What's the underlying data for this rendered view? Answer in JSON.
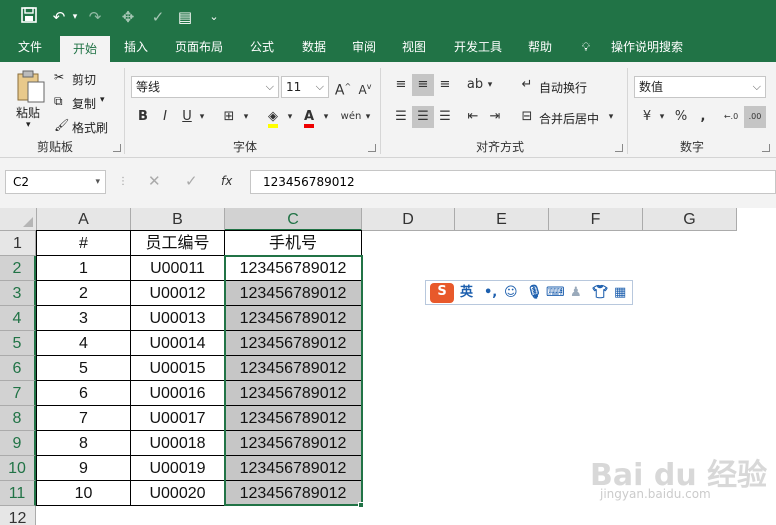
{
  "colors": {
    "accent": "#217346",
    "selection_fill": "#c6c6c6"
  },
  "qat": {
    "save_icon": "save-icon",
    "undo_icon": "undo-icon",
    "redo_icon": "redo-icon",
    "more": "⌄"
  },
  "tabs": [
    "文件",
    "开始",
    "插入",
    "页面布局",
    "公式",
    "数据",
    "审阅",
    "视图",
    "开发工具",
    "帮助"
  ],
  "tell_me": "操作说明搜索",
  "ribbon": {
    "clipboard": {
      "paste": "粘贴",
      "cut": "剪切",
      "copy": "复制",
      "format_painter": "格式刷",
      "label": "剪贴板"
    },
    "font": {
      "name": "等线",
      "size": "11",
      "bold": "B",
      "italic": "I",
      "underline": "U",
      "grow": "A",
      "shrink": "A",
      "phonetic": "wén",
      "label": "字体"
    },
    "alignment": {
      "wrap": "自动换行",
      "merge": "合并后居中",
      "label": "对齐方式"
    },
    "number": {
      "format": "数值",
      "percent": "%",
      "comma": ",",
      "label": "数字"
    }
  },
  "formula_bar": {
    "name_box": "C2",
    "fx": "fx",
    "content": "123456789012"
  },
  "sheet": {
    "columns": [
      "A",
      "B",
      "C",
      "D",
      "E",
      "F",
      "G"
    ],
    "rows": [
      "1",
      "2",
      "3",
      "4",
      "5",
      "6",
      "7",
      "8",
      "9",
      "10",
      "11",
      "12"
    ],
    "header": [
      "#",
      "员工编号",
      "手机号"
    ],
    "data": [
      [
        "1",
        "U00011",
        "123456789012"
      ],
      [
        "2",
        "U00012",
        "123456789012"
      ],
      [
        "3",
        "U00013",
        "123456789012"
      ],
      [
        "4",
        "U00014",
        "123456789012"
      ],
      [
        "5",
        "U00015",
        "123456789012"
      ],
      [
        "6",
        "U00016",
        "123456789012"
      ],
      [
        "7",
        "U00017",
        "123456789012"
      ],
      [
        "8",
        "U00018",
        "123456789012"
      ],
      [
        "9",
        "U00019",
        "123456789012"
      ],
      [
        "10",
        "U00020",
        "123456789012"
      ]
    ]
  },
  "ime": {
    "logo": "S",
    "mode": "英",
    "punct": "•,"
  },
  "watermark": {
    "brand": "Bai du 经验",
    "url": "jingyan.baidu.com"
  }
}
